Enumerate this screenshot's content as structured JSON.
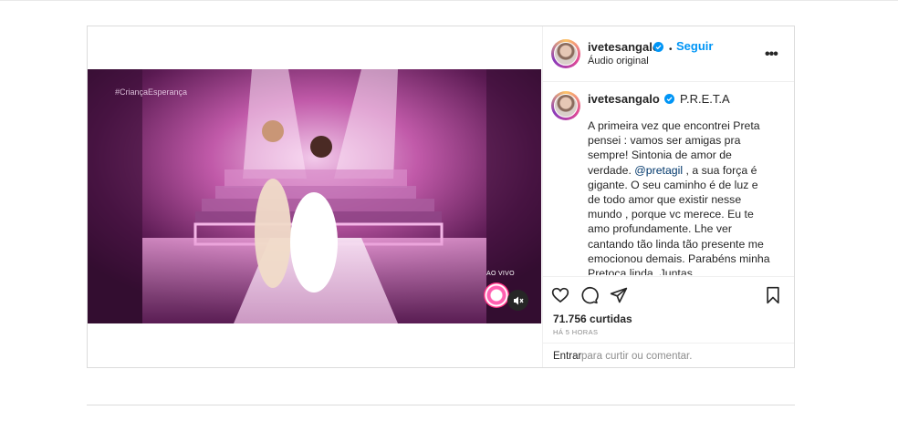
{
  "post": {
    "username": "ivetesangalo",
    "follow_separator": "•",
    "follow_label": "Seguir",
    "audio_label": "Áudio original",
    "more_label": "•••"
  },
  "video": {
    "hashtag": "#CriançaEsperança",
    "live_label": "AO VIVO"
  },
  "caption": {
    "username": "ivetesangalo",
    "title": "P.R.E.T.A",
    "text_1": "A primeira vez que encontrei Preta pensei : vamos ser amigas pra sempre! Sintonia de amor de verdade. ",
    "mention": "@pretagil",
    "text_2": " , a sua força é gigante. O seu caminho é de luz e de todo amor que existir nesse mundo , porque vc merece. Eu te amo profundamente. Lhe ver cantando tão linda tão presente me emocionou demais. Parabéns minha Pretoca linda. Juntas ateeeeeeeeeeee❤️ ❤️ ❤️ ❤️ viva vc"
  },
  "stats": {
    "likes": "71.756 curtidas",
    "time": "HÁ 5 HORAS"
  },
  "comment_box": {
    "enter": "Entrar",
    "rest": " para curtir ou comentar."
  },
  "icons": {
    "like": "heart-icon",
    "comment": "comment-icon",
    "share": "paper-plane-icon",
    "save": "bookmark-icon",
    "mute": "speaker-muted-icon"
  },
  "colors": {
    "link": "#0095f6",
    "text": "#262626",
    "muted": "#8e8e8e",
    "border": "#dbdbdb"
  }
}
